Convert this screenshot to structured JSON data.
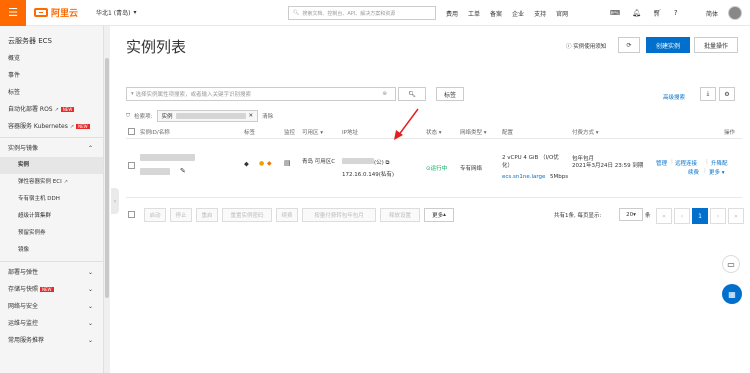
{
  "topbar": {
    "menu_icon": "menu-icon",
    "brand": "阿里云",
    "region": "华北1 (青岛)",
    "search_placeholder": "搜索文档、控制台、API、解决方案和资源",
    "links": [
      "费用",
      "工单",
      "备案",
      "企业",
      "支持",
      "官网"
    ],
    "lang": "简体"
  },
  "sidebar": {
    "title": "云服务器 ECS",
    "items": [
      {
        "label": "概览"
      },
      {
        "label": "事件"
      },
      {
        "label": "标签"
      },
      {
        "label": "自动化部署 ROS",
        "badge": "NEW"
      },
      {
        "label": "容器服务 Kubernetes",
        "badge": "NEW"
      }
    ],
    "group1": "实例与镜像",
    "group1_items": [
      "实例",
      "弹性容器实例 ECI",
      "专有宿主机 DDH",
      "超级计算集群",
      "预留实例券",
      "镜像"
    ],
    "groups": [
      "部署与弹性",
      "存储与快照",
      "网络与安全",
      "运维与监控",
      "常用服务推荐"
    ],
    "new_badge": "NEW"
  },
  "main": {
    "title": "实例列表",
    "help": "实例使用须知",
    "refresh_icon": "refresh-icon",
    "create": "创建实例",
    "batch": "批量操作",
    "filter_placeholder": "选择实例属性项搜索，或者输入关键字识别搜索",
    "tag_btn": "标签",
    "advanced": "高级搜索",
    "filter_label": "检索项:",
    "filter_chip_key": "实例",
    "clear": "清除",
    "columns": [
      "实例ID/名称",
      "标签",
      "监控",
      "可用区",
      "IP地址",
      "状态",
      "网络类型",
      "配置",
      "付费方式",
      "操作"
    ],
    "row": {
      "zone": "青岛 可用区C",
      "ip_public": "(公)",
      "ip_private": "172.16.0.149(私有)",
      "status": "运行中",
      "network": "专有网络",
      "config_line1": "2 vCPU 4 GiB （I/O优化）",
      "config_type": "ecs.sn1ne.large",
      "bandwidth": "5Mbps",
      "pay_type": "包年包月",
      "expire": "2021年3月24日 23:59 到期",
      "actions": [
        "管理",
        "远程连接",
        "升降配",
        "续费",
        "更多"
      ]
    },
    "footer_buttons": [
      "启动",
      "停止",
      "重启",
      "重置实例密码",
      "续费",
      "按量付费转包年包月",
      "释放设置",
      "更多"
    ],
    "summary": "共有1条, 每页显示:",
    "page_size": "20",
    "page_unit": "条",
    "current_page": "1"
  },
  "colors": {
    "brand": "#ff6a00",
    "primary": "#0070cc",
    "status_ok": "#00a854"
  }
}
